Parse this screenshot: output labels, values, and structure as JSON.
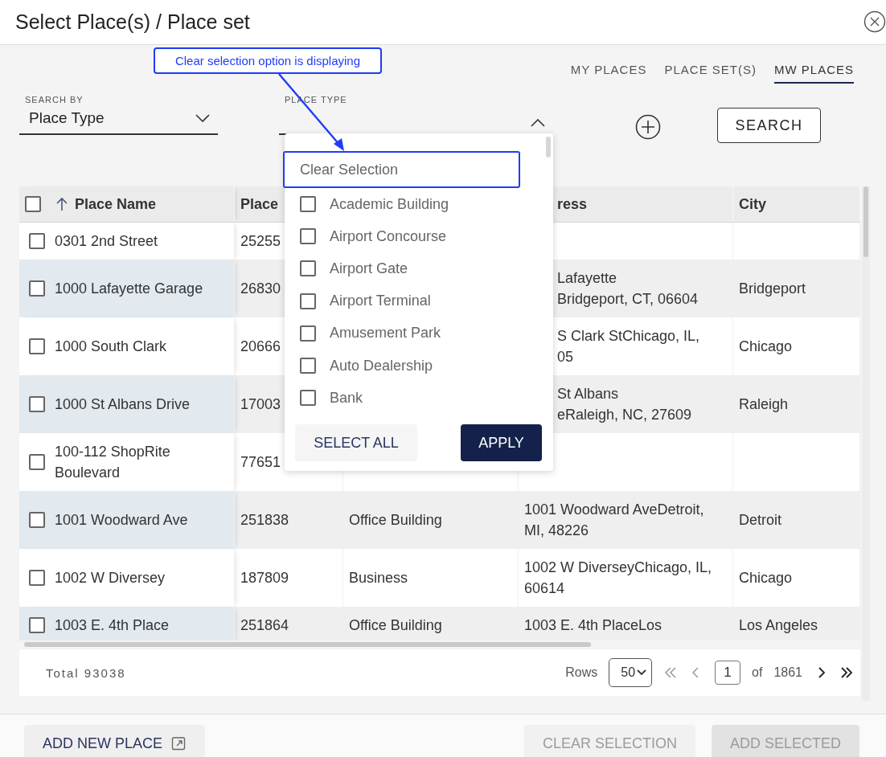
{
  "dialog": {
    "title": "Select Place(s) / Place set"
  },
  "annotation": {
    "text": "Clear selection option is displaying"
  },
  "tabs": [
    {
      "label": "MY PLACES",
      "selected": false
    },
    {
      "label": "PLACE SET(S)",
      "selected": false
    },
    {
      "label": "MW PLACES",
      "selected": true
    }
  ],
  "search_by": {
    "label": "SEARCH BY",
    "value": "Place Type",
    "expanded": false
  },
  "place_type": {
    "label": "PLACE TYPE",
    "expanded": true
  },
  "search_button": "SEARCH",
  "table": {
    "header_under_dropdown": true,
    "header_selected": false,
    "columns": [
      {
        "label": "Place Name",
        "sorted": true
      },
      {
        "label": "Place",
        "sorted": false
      },
      {},
      {
        "label": "ress",
        "sorted": false
      },
      {
        "label": "City",
        "sorted": false
      }
    ],
    "rows": [
      {
        "name": "0301 2nd Street",
        "place": "25255",
        "selected": false
      },
      {
        "name": "1000 Lafayette Garage",
        "place": "26830",
        "address": "Lafayette\nBridgeport, CT, 06604",
        "city": "Bridgeport",
        "selected": false,
        "under_dropdown": true
      },
      {
        "name": "1000 South Clark",
        "place": "20666",
        "address": "S Clark StChicago, IL,\n05",
        "city": "Chicago",
        "selected": false,
        "under_dropdown": true
      },
      {
        "name": "1000 St Albans Drive",
        "place": "17003",
        "address": "St Albans\neRaleigh, NC, 27609",
        "city": "Raleigh",
        "selected": false,
        "under_dropdown": true
      },
      {
        "name": "100-112 ShopRite Boulevard",
        "place": "77651",
        "selected": false
      },
      {
        "name": "1001 Woodward Ave",
        "place": "251838",
        "type": "Office Building",
        "address": "1001 Woodward AveDetroit, MI, 48226",
        "city": "Detroit",
        "selected": false,
        "under_dropdown": false
      },
      {
        "name": "1002 W Diversey",
        "place": "187809",
        "type": "Business",
        "address": "1002 W DiverseyChicago, IL, 60614",
        "city": "Chicago",
        "selected": false,
        "under_dropdown": false
      },
      {
        "name": "1003 E. 4th Place",
        "place": "251864",
        "type": "Office Building",
        "address": "1003 E. 4th PlaceLos",
        "city": "Los Angeles",
        "selected": false,
        "under_dropdown": false
      }
    ]
  },
  "dropdown": {
    "clear_option": "Clear Selection",
    "highlighted": true,
    "options": [
      {
        "label": "Academic Building",
        "checked": false
      },
      {
        "label": "Airport Concourse",
        "checked": false
      },
      {
        "label": "Airport Gate",
        "checked": false
      },
      {
        "label": "Airport Terminal",
        "checked": false
      },
      {
        "label": "Amusement Park",
        "checked": false
      },
      {
        "label": "Auto Dealership",
        "checked": false
      },
      {
        "label": "Bank",
        "checked": false
      }
    ],
    "buttons": [
      {
        "label": "SELECT ALL",
        "kind": "secondary"
      },
      {
        "label": "APPLY",
        "kind": "primary"
      }
    ]
  },
  "pagination": {
    "total": "Total 93038",
    "rows_label": "Rows",
    "rows_value": "50",
    "page": "1",
    "of": "of",
    "page_count": "1861"
  },
  "footer_buttons": [
    {
      "label": "ADD NEW PLACE",
      "kind": "external",
      "disabled": false
    },
    {
      "label": "CLEAR SELECTION",
      "kind": "secondary",
      "disabled": true
    },
    {
      "label": "ADD SELECTED",
      "kind": "primary",
      "disabled": true
    }
  ]
}
